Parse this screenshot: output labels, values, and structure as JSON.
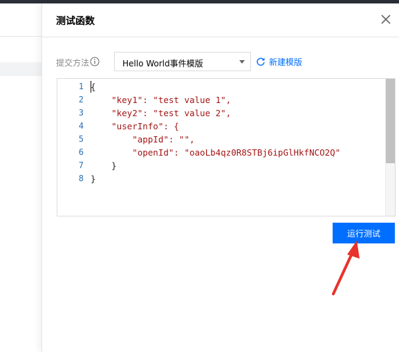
{
  "panel": {
    "title": "测试函数",
    "close_icon": "close-icon"
  },
  "form": {
    "submit_method_label": "提交方法",
    "info_icon": "info-icon",
    "template_select": {
      "value": "Hello World事件模版"
    },
    "refresh_icon": "refresh-icon",
    "new_template_label": "新建模版"
  },
  "editor": {
    "line_numbers": [
      "1",
      "2",
      "3",
      "4",
      "5",
      "6",
      "7",
      "8"
    ],
    "lines": [
      "{",
      "    \"key1\": \"test value 1\",",
      "    \"key2\": \"test value 2\",",
      "    \"userInfo\": {",
      "        \"appId\": \"\",",
      "        \"openId\": \"oaoLb4qz0R8STBj6ipGlHkfNCO2Q\"",
      "    }",
      "}"
    ]
  },
  "actions": {
    "run_test_label": "运行测试"
  },
  "annotation": {
    "arrow_color": "#e8322b"
  },
  "colors": {
    "accent": "#006eff",
    "topbar": "#2b2f38"
  }
}
